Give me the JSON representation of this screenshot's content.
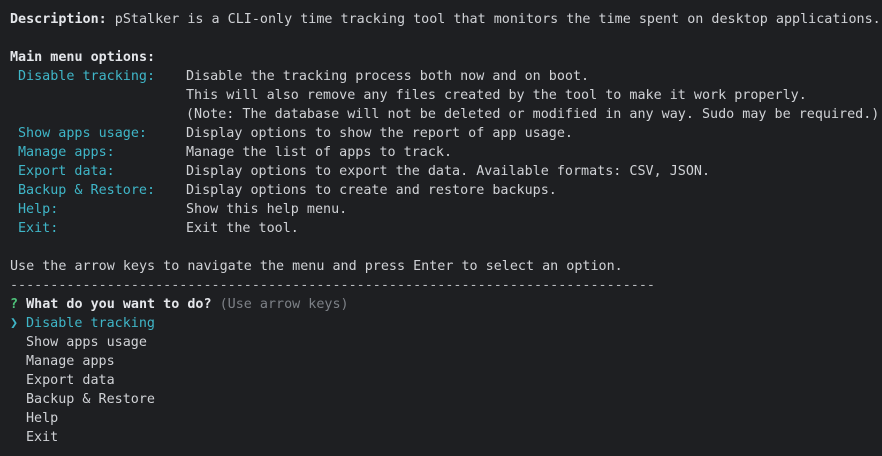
{
  "description": {
    "label": "Description:",
    "text": " pStalker is a CLI-only time tracking tool that monitors the time spent on desktop applications."
  },
  "main_menu": {
    "heading": "Main menu options:",
    "options": [
      {
        "name": "Disable tracking:",
        "lines": [
          "Disable the tracking process both now and on boot.",
          "This will also remove any files created by the tool to make it work properly.",
          "(Note: The database will not be deleted or modified in any way. Sudo may be required.)"
        ]
      },
      {
        "name": "Show apps usage:",
        "lines": [
          "Display options to show the report of app usage."
        ]
      },
      {
        "name": "Manage apps:",
        "lines": [
          "Manage the list of apps to track."
        ]
      },
      {
        "name": "Export data:",
        "lines": [
          "Display options to export the data. Available formats: CSV, JSON."
        ]
      },
      {
        "name": "Backup & Restore:",
        "lines": [
          "Display options to create and restore backups."
        ]
      },
      {
        "name": "Help:",
        "lines": [
          "Show this help menu."
        ]
      },
      {
        "name": "Exit:",
        "lines": [
          "Exit the tool."
        ]
      }
    ]
  },
  "instruction": "Use the arrow keys to navigate the menu and press Enter to select an option.",
  "separator": "--------------------------------------------------------------------------------",
  "prompt": {
    "mark": "?",
    "question": "What do you want to do?",
    "hint": "(Use arrow keys)",
    "pointer": "❯",
    "choices": [
      "Disable tracking",
      "Show apps usage",
      "Manage apps",
      "Export data",
      "Backup & Restore",
      "Help",
      "Exit"
    ],
    "selected_index": 0
  },
  "colors": {
    "background": "#1e1f22",
    "accent": "#3fb6c8",
    "prompt_mark": "#4ec27a",
    "hint": "#7d8187"
  }
}
